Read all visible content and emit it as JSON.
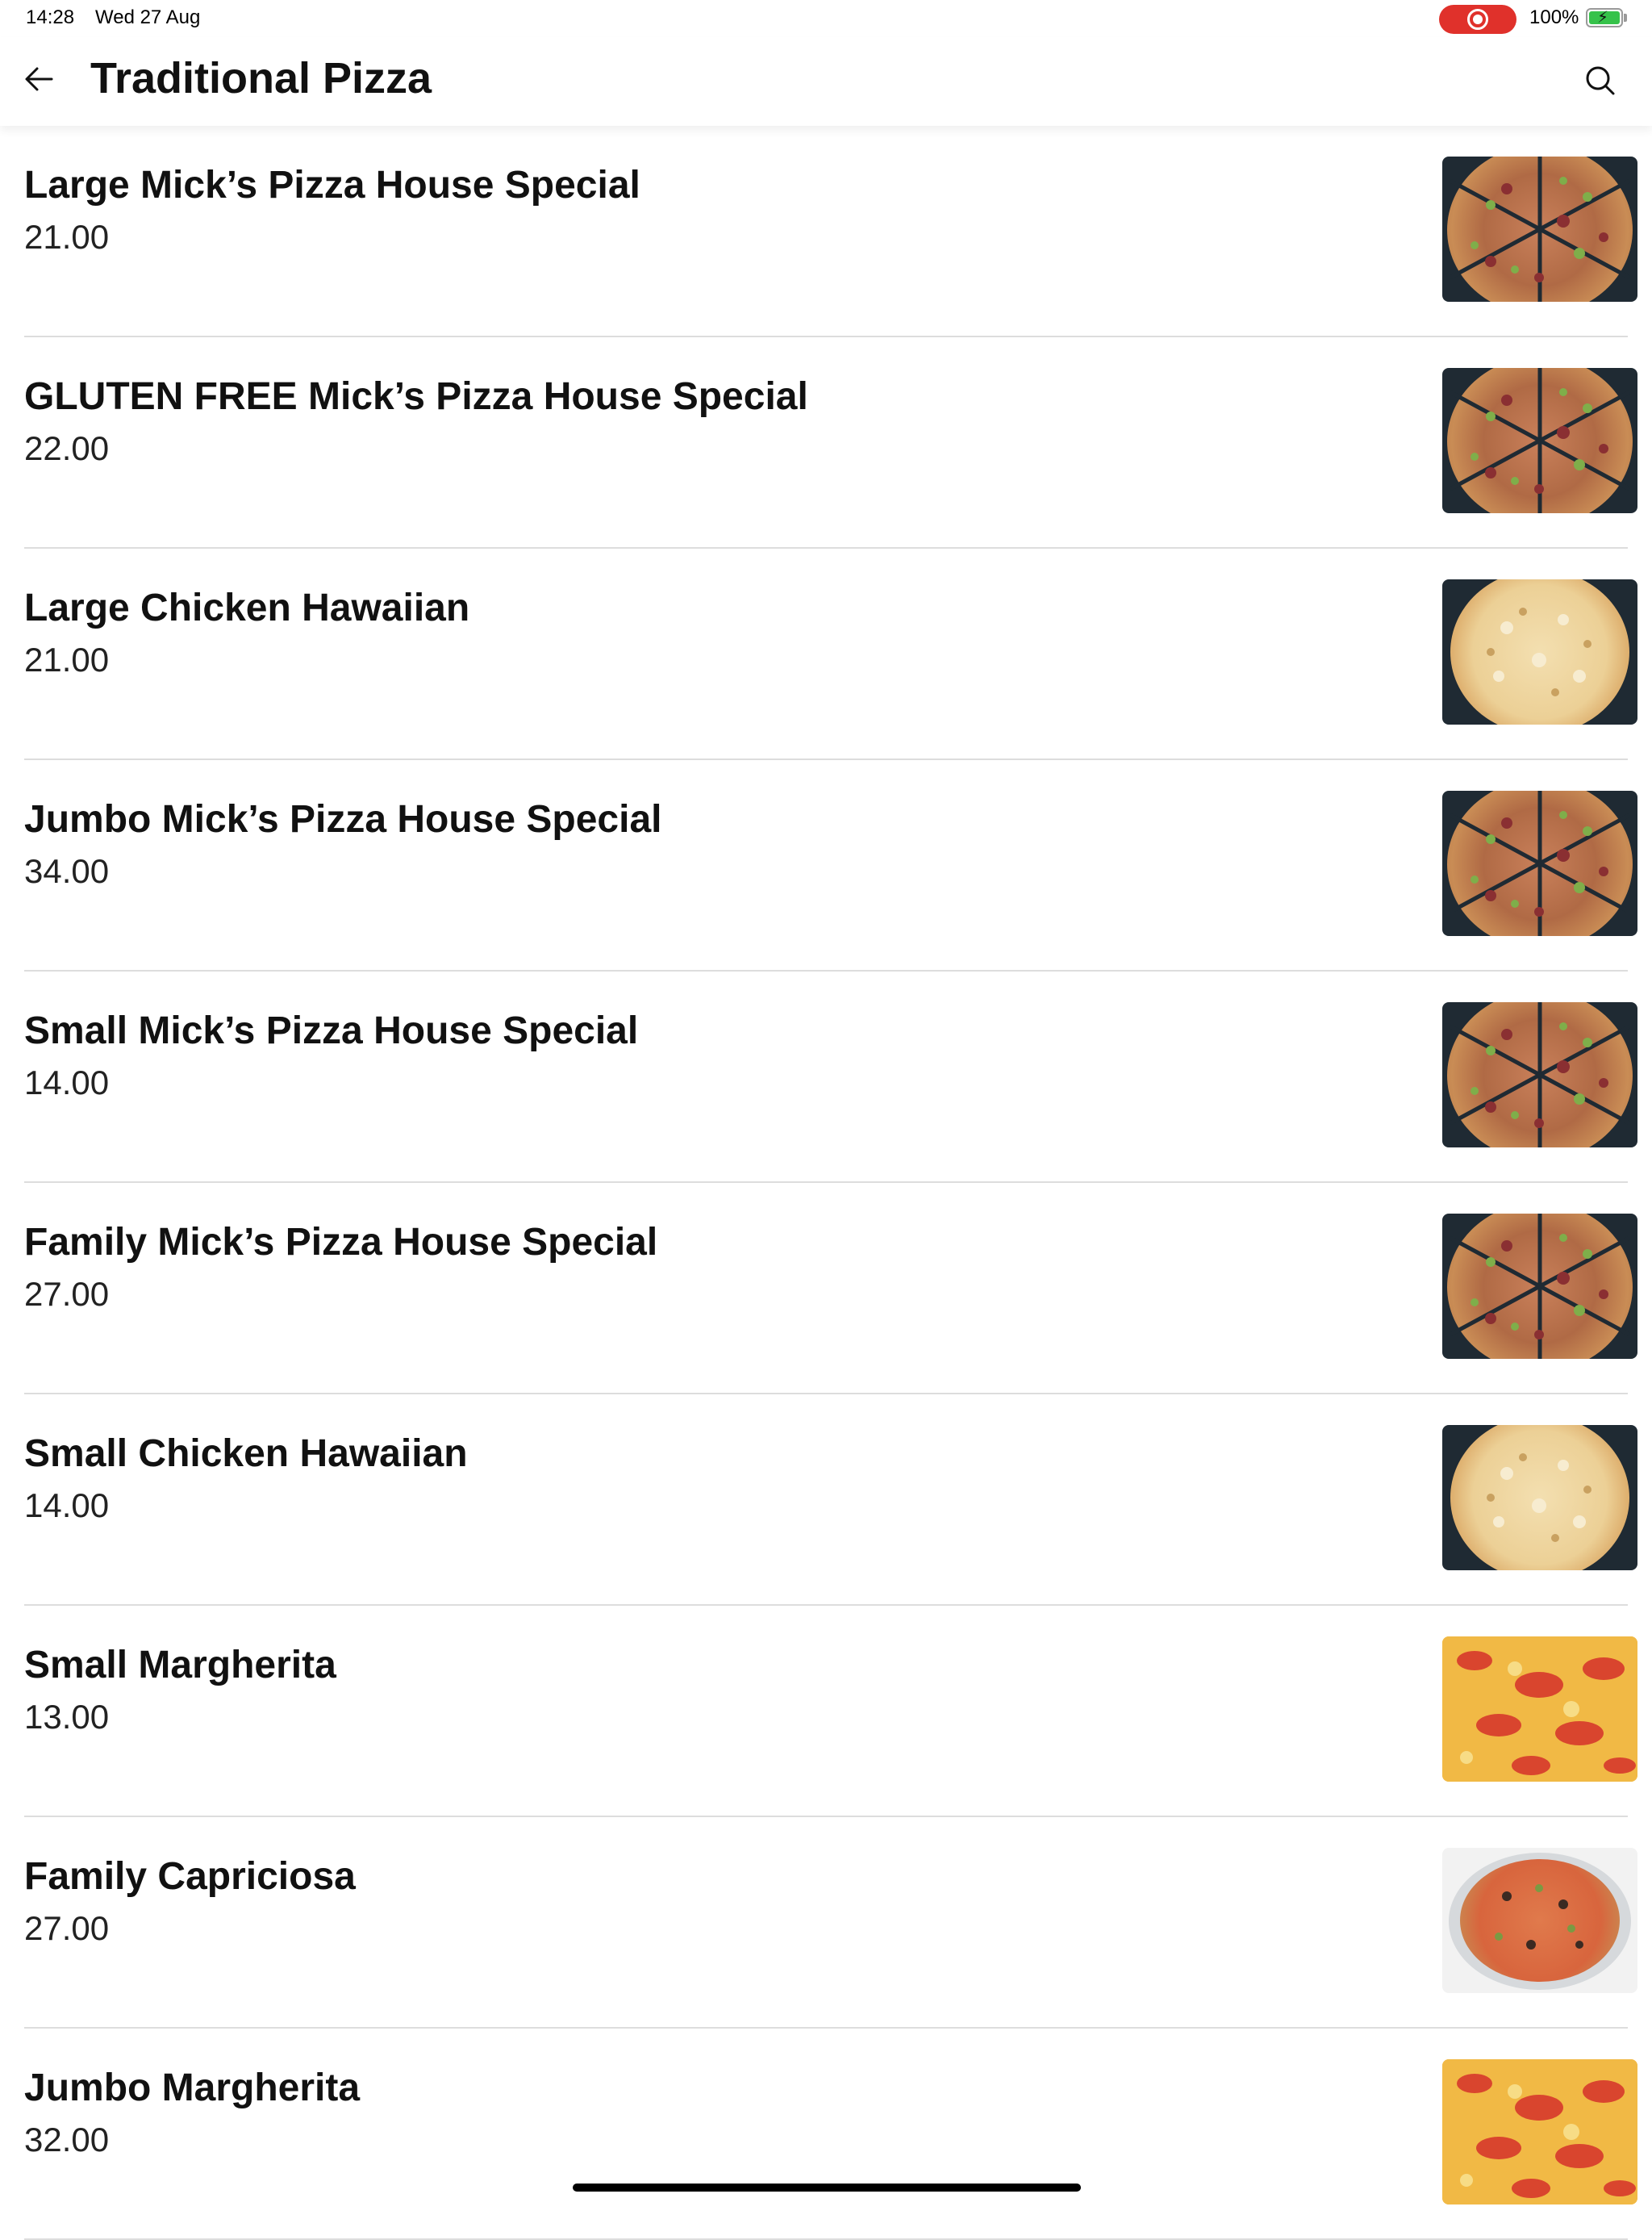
{
  "status_bar": {
    "time": "14:28",
    "date": "Wed 27 Aug",
    "battery": "100%",
    "recording_color": "#e0312b",
    "battery_color": "#36c24a"
  },
  "header": {
    "title": "Traditional Pizza",
    "back_icon": "arrow-left-icon",
    "search_icon": "search-icon"
  },
  "items": [
    {
      "name": "Large Mick’s Pizza House Special",
      "price": "21.00",
      "image": "supreme-pizza"
    },
    {
      "name": "GLUTEN FREE Mick’s Pizza House Special",
      "price": "22.00",
      "image": "supreme-pizza"
    },
    {
      "name": "Large Chicken Hawaiian",
      "price": "21.00",
      "image": "hawaiian-pizza"
    },
    {
      "name": "Jumbo Mick’s Pizza House Special",
      "price": "34.00",
      "image": "supreme-pizza"
    },
    {
      "name": "Small Mick’s Pizza House Special",
      "price": "14.00",
      "image": "supreme-pizza"
    },
    {
      "name": "Family Mick’s Pizza House Special",
      "price": "27.00",
      "image": "supreme-pizza"
    },
    {
      "name": "Small Chicken Hawaiian",
      "price": "14.00",
      "image": "hawaiian-pizza"
    },
    {
      "name": "Small Margherita",
      "price": "13.00",
      "image": "margherita-pizza"
    },
    {
      "name": "Family Capriciosa",
      "price": "27.00",
      "image": "capriciosa-pizza"
    },
    {
      "name": "Jumbo Margherita",
      "price": "32.00",
      "image": "margherita-pizza"
    }
  ]
}
